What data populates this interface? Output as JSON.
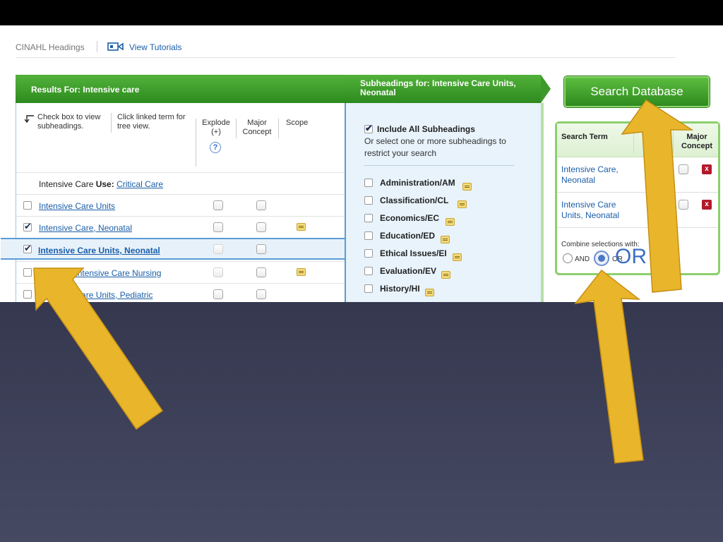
{
  "header": {
    "crumb": "CINAHL Headings",
    "tutorials": "View Tutorials"
  },
  "results": {
    "title": "Results For: Intensive care",
    "hint_check": "Check box to view subheadings.",
    "hint_click": "Click linked term for tree view.",
    "col_explode": "Explode (+)",
    "col_major": "Major Concept",
    "col_scope": "Scope",
    "help": "?",
    "use_row": {
      "term": "Intensive Care",
      "use_label": "Use:",
      "link": "Critical Care"
    },
    "rows": [
      {
        "label": "Intensive Care Units",
        "checked": false
      },
      {
        "label": "Intensive Care, Neonatal",
        "checked": true
      },
      {
        "label": "Intensive Care Units, Neonatal",
        "checked": true
      },
      {
        "label": "Neonatal Intensive Care Nursing",
        "checked": false
      },
      {
        "label": "Intensive Care Units, Pediatric",
        "checked": false
      }
    ]
  },
  "subheadings": {
    "title": "Subheadings for: Intensive Care Units, Neonatal",
    "include_all": "Include All Subheadings",
    "note": "Or select one or more subheadings to restrict your search",
    "items": [
      "Administration/AM",
      "Classification/CL",
      "Economics/EC",
      "Education/ED",
      "Ethical Issues/EI",
      "Evaluation/EV",
      "History/HI"
    ]
  },
  "search_button": "Search Database",
  "terms": {
    "col_term": "Search Term",
    "col_explode_partial": "o",
    "col_major": "Major Concept",
    "rows": [
      {
        "name": "Intensive Care, Neonatal"
      },
      {
        "name": "Intensive Care Units, Neonatal"
      }
    ],
    "delete": "x",
    "combine": "Combine selections with:",
    "and": "AND",
    "or_small": "OR",
    "or_big": "OR"
  },
  "colors": {
    "green": "#3d9a2a",
    "link": "#1a5ea8",
    "arrow": "#e9b52b"
  }
}
